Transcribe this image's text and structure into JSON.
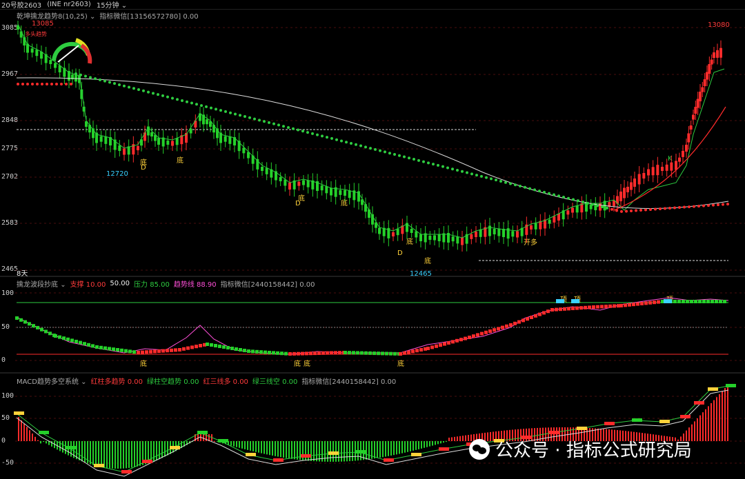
{
  "topbar": {
    "instrument": "20号胶2603",
    "code": "(INE nr2603)",
    "timeframe": "15分钟"
  },
  "main_panel": {
    "title": "乾坤擒龙趋势8(10,25)",
    "wechat": "指标微信[13156572780] 0.00",
    "y_labels": [
      "3085",
      "2967",
      "2848",
      "2775",
      "2702",
      "2583",
      "2465"
    ],
    "high_left": "13085",
    "high_right": "13080",
    "low1": "12720",
    "low2": "12465",
    "days": "8天",
    "small_label": "多头趋势",
    "signals": [
      "底",
      "D",
      "底",
      "底",
      "D",
      "底",
      "底",
      "D",
      "底",
      "开多",
      "K"
    ]
  },
  "panel2": {
    "title": "擒龙波段抄底",
    "support": "支撑 10.00",
    "mid": "50.00",
    "pressure": "压力 85.00",
    "trend": "趋势线 88.90",
    "wechat": "指标微信[2440158442] 0.00",
    "y_labels": [
      "100",
      "50",
      "0"
    ],
    "signals_bottom": [
      "底",
      "底",
      "底",
      "底"
    ],
    "signals_top": [
      "顶",
      "顶",
      "顶"
    ]
  },
  "panel3": {
    "title": "MACD趋势多空系统",
    "red_bar": "红柱多趋势 0.00",
    "green_bar": "绿柱空趋势 0.00",
    "red_line": "红三线多 0.00",
    "green_line": "绿三线空 0.00",
    "wechat": "指标微信[2440158442] 0.00",
    "y_labels": [
      "100",
      "50",
      "0",
      "-50"
    ]
  },
  "watermark": "公众号 · 指标公式研究局",
  "colors": {
    "up": "#ff2b2b",
    "down": "#25d12a",
    "bg": "#000000",
    "grid": "#5a1010"
  }
}
